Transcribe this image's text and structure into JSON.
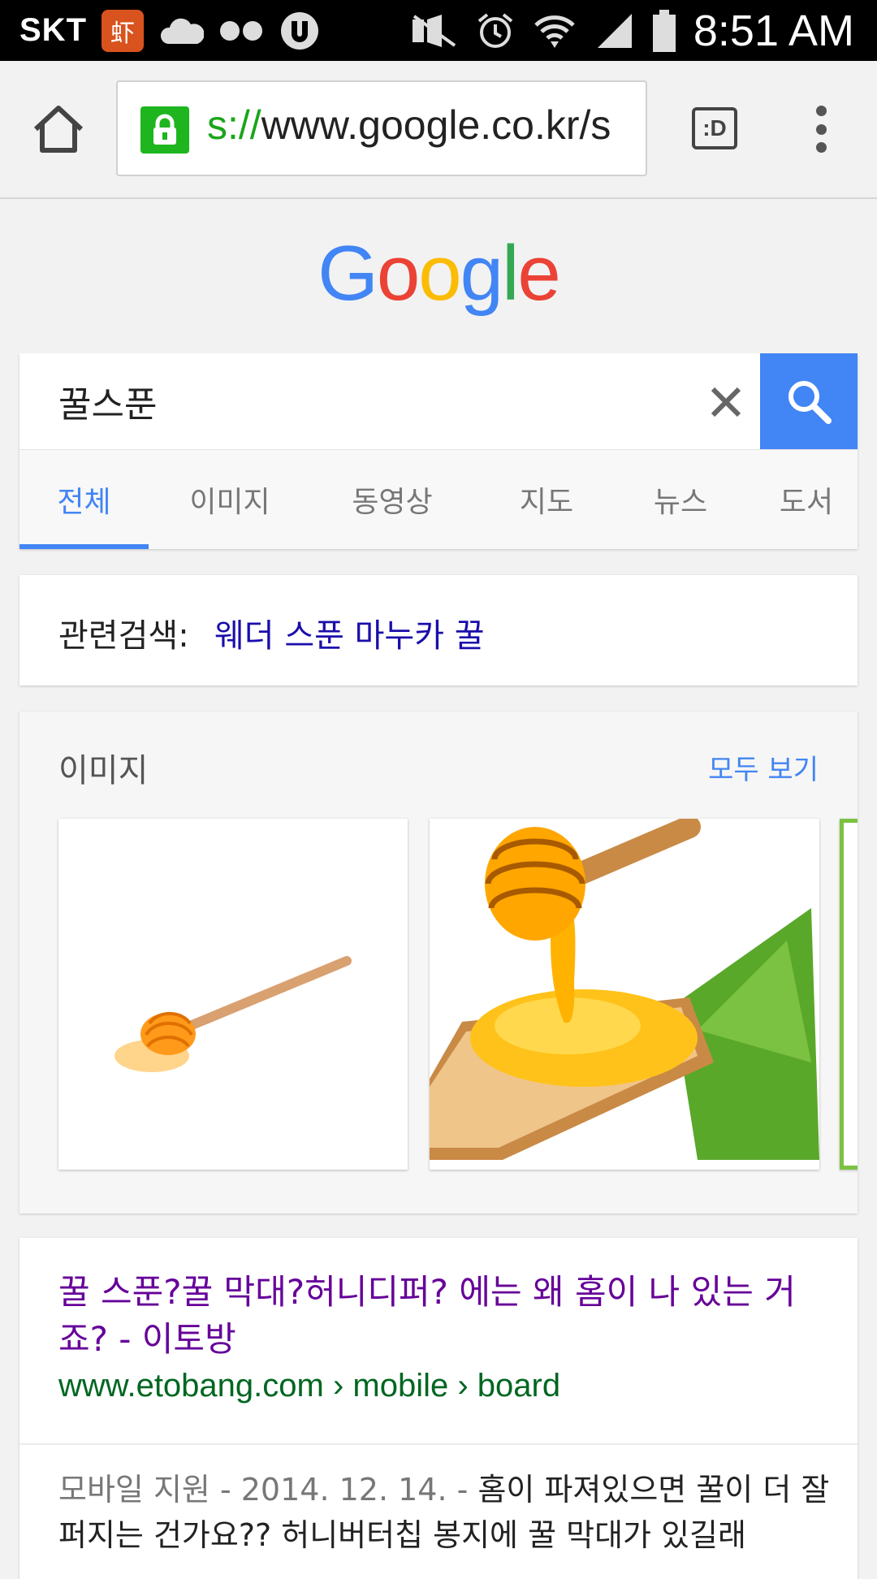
{
  "status_bar": {
    "carrier": "SKT",
    "app_icon_glyph": "虾",
    "time": "8:51 AM",
    "icons": [
      "cloud-icon",
      "dots-icon",
      "app-u-icon",
      "mute-icon",
      "alarm-icon",
      "wifi-icon",
      "signal-icon",
      "battery-icon"
    ]
  },
  "browser": {
    "url_scheme": "s://",
    "url_rest": "www.google.co.kr/s",
    "tab_switcher_label": ":D"
  },
  "logo": [
    "G",
    "o",
    "o",
    "g",
    "l",
    "e"
  ],
  "search": {
    "query": "꿀스푼"
  },
  "tabs": [
    {
      "label": "전체",
      "active": true
    },
    {
      "label": "이미지"
    },
    {
      "label": "동영상"
    },
    {
      "label": "지도"
    },
    {
      "label": "뉴스"
    },
    {
      "label": "도서"
    }
  ],
  "related": {
    "label": "관련검색:",
    "link": "웨더 스푼 마누카 꿀"
  },
  "images": {
    "title": "이미지",
    "more": "모두 보기"
  },
  "result": {
    "title": "꿀 스푼?꿀 막대?허니디퍼? 에는 왜 홈이 나 있는 거죠? - 이토방",
    "url": "www.etobang.com › mobile › board",
    "snippet_meta": "모바일 지원 - 2014. 12. 14. - ",
    "snippet_text": "홈이 파져있으면 꿀이 더 잘퍼지는 건가요?? 허니버터칩 봉지에 꿀 막대가 있길래"
  },
  "colors": {
    "google_blue": "#4285f4",
    "visited_link": "#660099",
    "url_green": "#006621",
    "related_link": "#1a0dab"
  }
}
